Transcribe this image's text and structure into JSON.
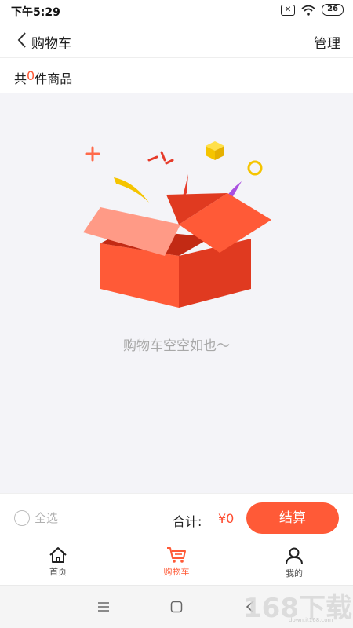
{
  "status_bar": {
    "time": "下午5:29",
    "battery": "26"
  },
  "header": {
    "title": "购物车",
    "manage": "管理"
  },
  "summary": {
    "prefix": "共",
    "count": "0",
    "suffix": "件商品"
  },
  "empty_state": {
    "message": "购物车空空如也～"
  },
  "footer": {
    "select_all": "全选",
    "total_label": "合计:",
    "total_value": "¥0",
    "checkout": "结算"
  },
  "tabs": [
    {
      "label": "首页",
      "icon": "home-icon",
      "active": false
    },
    {
      "label": "购物车",
      "icon": "cart-icon",
      "active": true
    },
    {
      "label": "我的",
      "icon": "user-icon",
      "active": false
    }
  ],
  "watermark": {
    "text": "168下载",
    "url": "down.it168.com"
  },
  "colors": {
    "accent": "#ff5a37",
    "background": "#f4f4f8"
  }
}
